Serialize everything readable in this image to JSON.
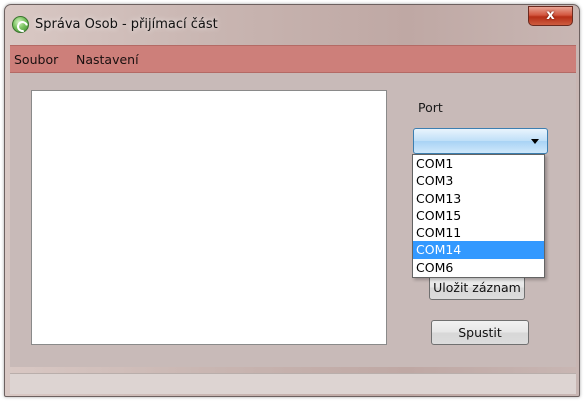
{
  "window": {
    "title": "Správa Osob - přijímací část",
    "close_label": "x",
    "app_icon": "green-circle-app-icon"
  },
  "menu": {
    "items": [
      {
        "label": "Soubor"
      },
      {
        "label": "Nastavení"
      }
    ]
  },
  "port": {
    "label": "Port",
    "selected_value": "",
    "options": [
      {
        "label": "COM1"
      },
      {
        "label": "COM3"
      },
      {
        "label": "COM13"
      },
      {
        "label": "COM15"
      },
      {
        "label": "COM11"
      },
      {
        "label": "COM14",
        "highlighted": true
      },
      {
        "label": "COM6"
      }
    ]
  },
  "buttons": {
    "save_label": "Uložit záznam",
    "start_label": "Spustit"
  },
  "colors": {
    "menubar": "#cd7f7a",
    "highlight": "#3399ff",
    "close_button": "#c94f39"
  }
}
